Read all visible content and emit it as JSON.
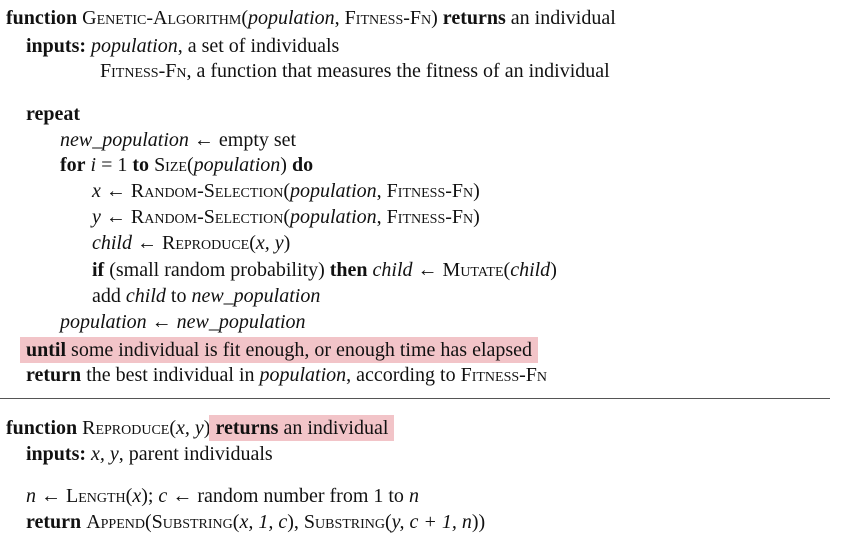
{
  "kw": {
    "function": "function",
    "returns": "returns",
    "inputs": "inputs:",
    "repeat": "repeat",
    "for": "for",
    "to": "to",
    "do": "do",
    "if": "if",
    "then": "then",
    "until": "until",
    "return": "return"
  },
  "algo1": {
    "name": "Genetic-Algorithm(",
    "param_population": "population",
    "param_sep": ", ",
    "param_fitness": "Fitness-Fn",
    "param_close": ")",
    "returns_tail": " an individual",
    "input1_name": "population",
    "input1_desc": ", a set of individuals",
    "input2_name": "Fitness-Fn",
    "input2_desc": ", a function that measures the fitness of an individual",
    "l_newpop_var": "new_population",
    "l_newpop_arrow": " ← empty set",
    "l_for_i": " i ",
    "l_for_eq": "= 1 ",
    "l_for_size": " Size(",
    "l_for_pop": "population",
    "l_for_close": ") ",
    "l_x_var": "x",
    "l_x_arrow": " ← ",
    "l_randsel": "Random-Selection(",
    "l_y_var": "y",
    "l_y_arrow": " ← ",
    "l_randsel2": "Random-Selection(",
    "l_child_var": "child",
    "l_child_arrow": " ← ",
    "l_reproduce": "Reproduce(",
    "l_reproduce_args": "x, y",
    "l_if_cond": " (small random probability) ",
    "l_if_child": " child",
    "l_if_arrow": " ← ",
    "l_mutate": "Mutate(",
    "l_mutate_arg": "child",
    "l_add": "add ",
    "l_add_child": "child",
    "l_add_to": " to ",
    "l_add_newpop": "new_population",
    "l_popassign_var": "population",
    "l_popassign_arrow": " ← ",
    "l_popassign_val": "new_population",
    "l_until_text": " some individual is fit enough, or enough time has elapsed",
    "l_return_text": " the best individual in ",
    "l_return_pop": "population",
    "l_return_acc": ", according to ",
    "l_return_fit": "Fitness-Fn"
  },
  "algo2": {
    "name": "Reproduce(",
    "args": "x, y",
    "close": ")",
    "returns_tail": " an individual",
    "inputs_vars": "x, y",
    "inputs_desc": ", parent individuals",
    "l_n_var": "n",
    "l_n_arrow": " ← ",
    "l_length": "Length(",
    "l_length_arg": "x",
    "l_length_close": "); ",
    "l_c_var": "c",
    "l_c_arrow": " ← ",
    "l_c_text": "random number from 1 to ",
    "l_c_n": "n",
    "l_ret_append": "Append(",
    "l_ret_sub1": "Substring(",
    "l_ret_sub1_args": "x, 1, c",
    "l_ret_sep": "), ",
    "l_ret_sub2": "Substring(",
    "l_ret_sub2_args": "y, c + 1, n",
    "l_ret_close": "))"
  }
}
